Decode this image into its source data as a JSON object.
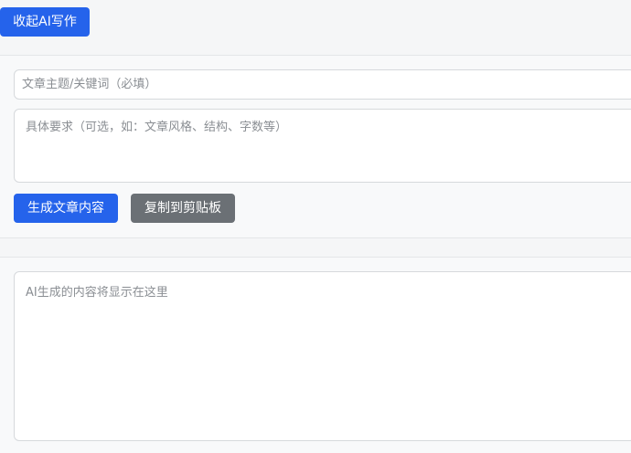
{
  "toolbar": {
    "toggle_label": "收起AI写作"
  },
  "form": {
    "topic_placeholder": "文章主题/关键词（必填）",
    "requirements_placeholder": "具体要求（可选，如：文章风格、结构、字数等）",
    "generate_label": "生成文章内容",
    "copy_label": "复制到剪贴板"
  },
  "output": {
    "placeholder": "AI生成的内容将显示在这里"
  },
  "colors": {
    "primary": "#2563eb",
    "secondary": "#6b7075",
    "background": "#f5f6f7"
  }
}
